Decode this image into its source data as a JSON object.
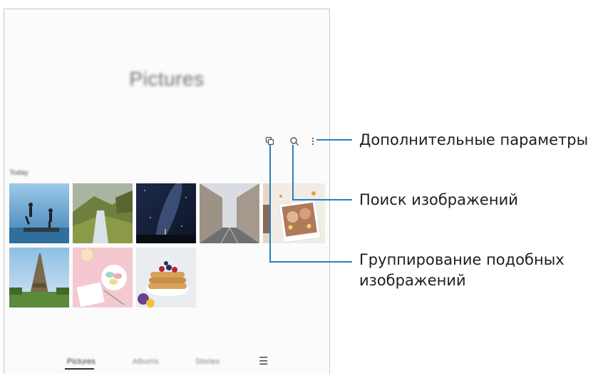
{
  "screen": {
    "title": "Pictures",
    "date_label": "Today",
    "photos": [
      {
        "subject": "people-jumping-on-pier"
      },
      {
        "subject": "mountain-waterfall-landscape"
      },
      {
        "subject": "milky-way-night-sky"
      },
      {
        "subject": "city-street-buildings"
      },
      {
        "subject": "group-of-friends"
      },
      {
        "subject": "eiffel-tower"
      },
      {
        "subject": "macarons-and-notebook"
      },
      {
        "subject": "pancakes-with-berries"
      }
    ],
    "bottom_nav": {
      "tabs": [
        "Pictures",
        "Albums",
        "Stories"
      ],
      "active_tab": "Pictures",
      "menu_icon": "hamburger-icon"
    },
    "toolbar_icons": [
      "group-similar-icon",
      "search-icon",
      "more-options-icon"
    ]
  },
  "callouts": {
    "more_options": "Дополнительные параметры",
    "search": "Поиск изображений",
    "group_similar_line1": "Группирование подобных",
    "group_similar_line2": "изображений"
  },
  "colors": {
    "leader_line": "#2a7fbf",
    "phone_border": "#c7c7c7"
  }
}
